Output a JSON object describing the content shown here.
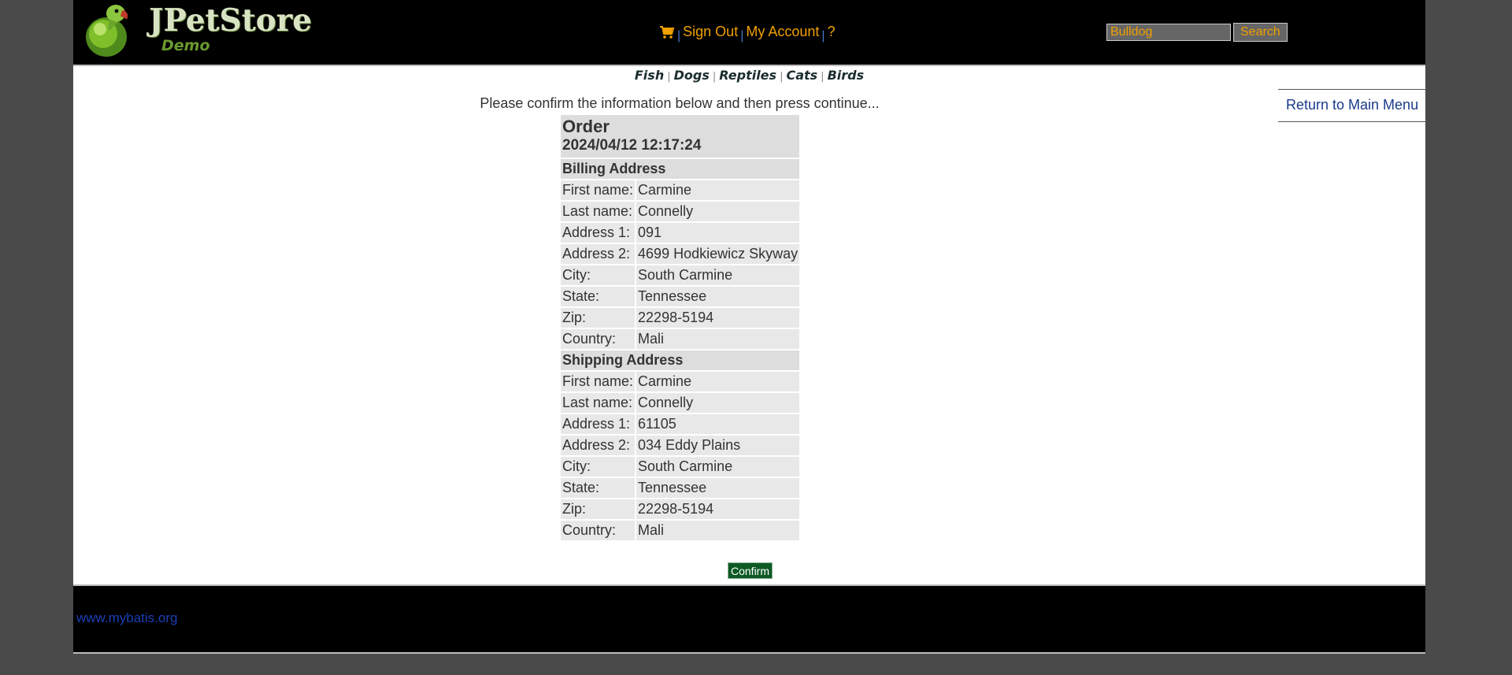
{
  "header": {
    "logo_title": "JPetStore",
    "logo_subtitle": "Demo",
    "menu": {
      "cart_icon": "shopping-cart-icon",
      "sign_out": "Sign Out",
      "my_account": "My Account",
      "help": "?"
    },
    "search": {
      "value": "Bulldog",
      "button": "Search"
    }
  },
  "categories": [
    "Fish",
    "Dogs",
    "Reptiles",
    "Cats",
    "Birds"
  ],
  "return_menu": "Return to Main Menu",
  "instructions": "Please confirm the information below and then press continue...",
  "order": {
    "title": "Order",
    "date": "2024/04/12 12:17:24",
    "billing": {
      "heading": "Billing Address",
      "rows": [
        {
          "label": "First name:",
          "value": "Carmine"
        },
        {
          "label": "Last name:",
          "value": "Connelly"
        },
        {
          "label": "Address 1:",
          "value": "091"
        },
        {
          "label": "Address 2:",
          "value": "4699 Hodkiewicz Skyway"
        },
        {
          "label": "City:",
          "value": "South Carmine"
        },
        {
          "label": "State:",
          "value": "Tennessee"
        },
        {
          "label": "Zip:",
          "value": "22298-5194"
        },
        {
          "label": "Country:",
          "value": "Mali"
        }
      ]
    },
    "shipping": {
      "heading": "Shipping Address",
      "rows": [
        {
          "label": "First name:",
          "value": "Carmine"
        },
        {
          "label": "Last name:",
          "value": "Connelly"
        },
        {
          "label": "Address 1:",
          "value": "61105"
        },
        {
          "label": "Address 2:",
          "value": "034 Eddy Plains"
        },
        {
          "label": "City:",
          "value": "South Carmine"
        },
        {
          "label": "State:",
          "value": "Tennessee"
        },
        {
          "label": "Zip:",
          "value": "22298-5194"
        },
        {
          "label": "Country:",
          "value": "Mali"
        }
      ]
    }
  },
  "confirm_button": "Confirm",
  "footer": {
    "link": "www.mybatis.org"
  },
  "colors": {
    "header_bg": "#000000",
    "menu_link": "#f0a000",
    "confirm_bg": "#0e5a24",
    "footer_link": "#1b3fb8"
  }
}
